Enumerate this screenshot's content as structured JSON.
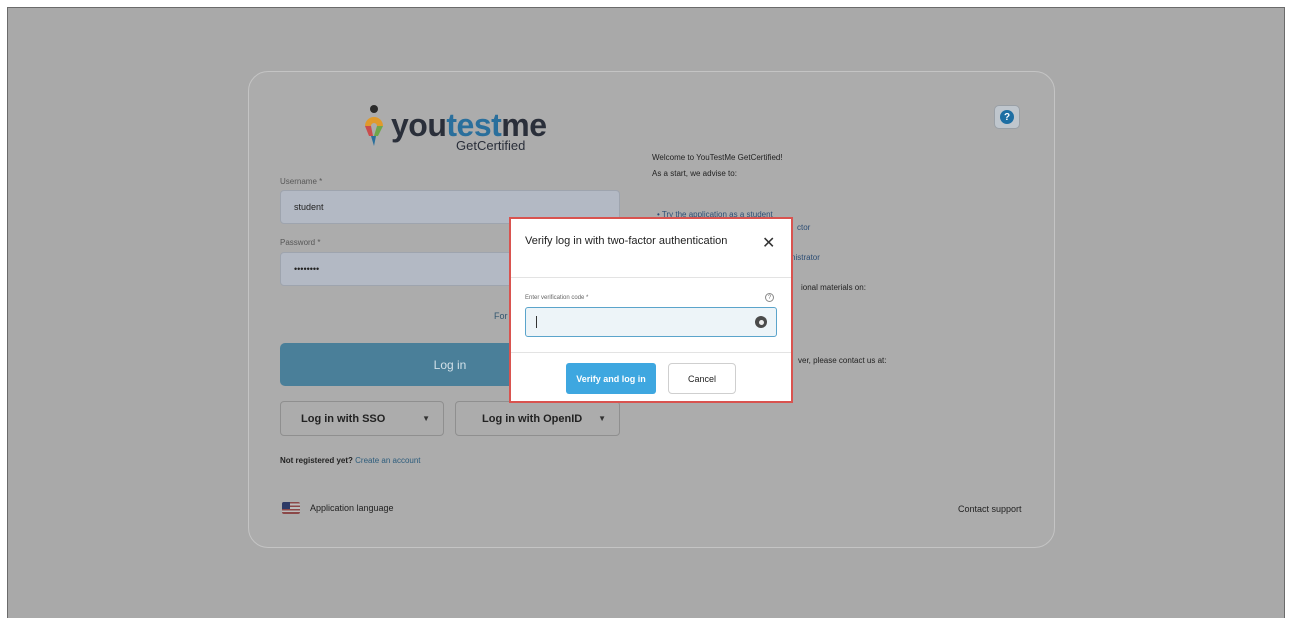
{
  "brand": {
    "logo_text_prefix": "you",
    "logo_text_accent": "test",
    "logo_text_suffix": "me",
    "logo_subtitle": "GetCertified"
  },
  "login_form": {
    "username_label": "Username *",
    "username_value": "student",
    "password_label": "Password *",
    "password_value": "••••••••",
    "forgot_partial": "For",
    "login_button": "Log in",
    "sso_button": "Log in with SSO",
    "openid_button": "Log in with OpenID",
    "not_registered": "Not registered yet?",
    "create_account": "Create an account"
  },
  "welcome": {
    "line1": "Welcome to YouTestMe GetCertified!",
    "line2": "As a start, we advise to:",
    "link1": "• Try the application as a student",
    "partial1": "ctor",
    "partial2": "nistrator",
    "partial3": "ional materials on:",
    "partial4": "ver, please contact us at:"
  },
  "footer": {
    "language": "Application language",
    "support": "Contact support"
  },
  "dialog": {
    "title": "Verify log in with two-factor authentication",
    "code_label": "Enter verification code *",
    "code_value": "",
    "verify_button": "Verify and log in",
    "cancel_button": "Cancel"
  },
  "colors": {
    "overlay": "#a9a9a9",
    "primary": "#3ea7e0",
    "highlight_border": "#d9534f"
  },
  "icons": [
    "help-icon",
    "close-icon",
    "info-icon",
    "eye-icon",
    "chevron-down-icon",
    "us-flag-icon"
  ]
}
